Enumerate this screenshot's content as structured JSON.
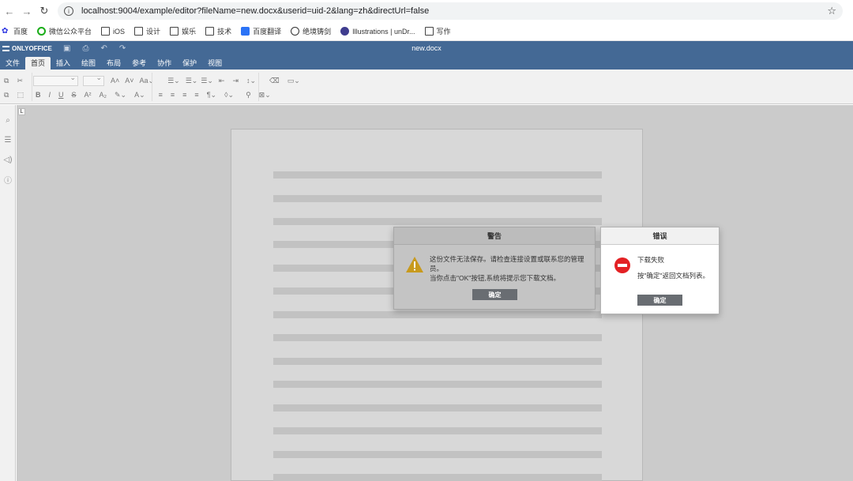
{
  "browser": {
    "url": "localhost:9004/example/editor?fileName=new.docx&userid=uid-2&lang=zh&directUrl=false",
    "bookmarks": [
      {
        "label": "百度",
        "icon": "baidu-icon"
      },
      {
        "label": "微信公众平台",
        "icon": "wechat-icon"
      },
      {
        "label": "iOS",
        "icon": "folder-icon"
      },
      {
        "label": "设计",
        "icon": "folder-icon"
      },
      {
        "label": "娱乐",
        "icon": "folder-icon"
      },
      {
        "label": "技术",
        "icon": "folder-icon"
      },
      {
        "label": "百度翻译",
        "icon": "translate-icon"
      },
      {
        "label": "绝境铸剑",
        "icon": "globe-icon"
      },
      {
        "label": "Illustrations | unDr...",
        "icon": "undraw-icon"
      },
      {
        "label": "写作",
        "icon": "folder-icon"
      }
    ]
  },
  "editor": {
    "logo": "ONLYOFFICE",
    "doc_name": "new.docx",
    "menu": [
      "文件",
      "首页",
      "插入",
      "绘图",
      "布局",
      "参考",
      "协作",
      "保护",
      "视图"
    ],
    "active_menu": "首页"
  },
  "warning_dialog": {
    "title": "警告",
    "message_line1": "这份文件无法保存。请检查连接设置或联系您的管理员。",
    "message_line2": "当你点击\"OK\"按钮,系统将提示您下载文档。",
    "ok_label": "确定"
  },
  "error_dialog": {
    "title": "错误",
    "message_line1": "下载失败",
    "message_line2": "按\"确定\"返回文档列表。",
    "ok_label": "确定"
  },
  "colors": {
    "header_blue": "#446995",
    "warning_yellow": "#d4a017",
    "error_red": "#e32124",
    "button_gray": "#696d72"
  }
}
